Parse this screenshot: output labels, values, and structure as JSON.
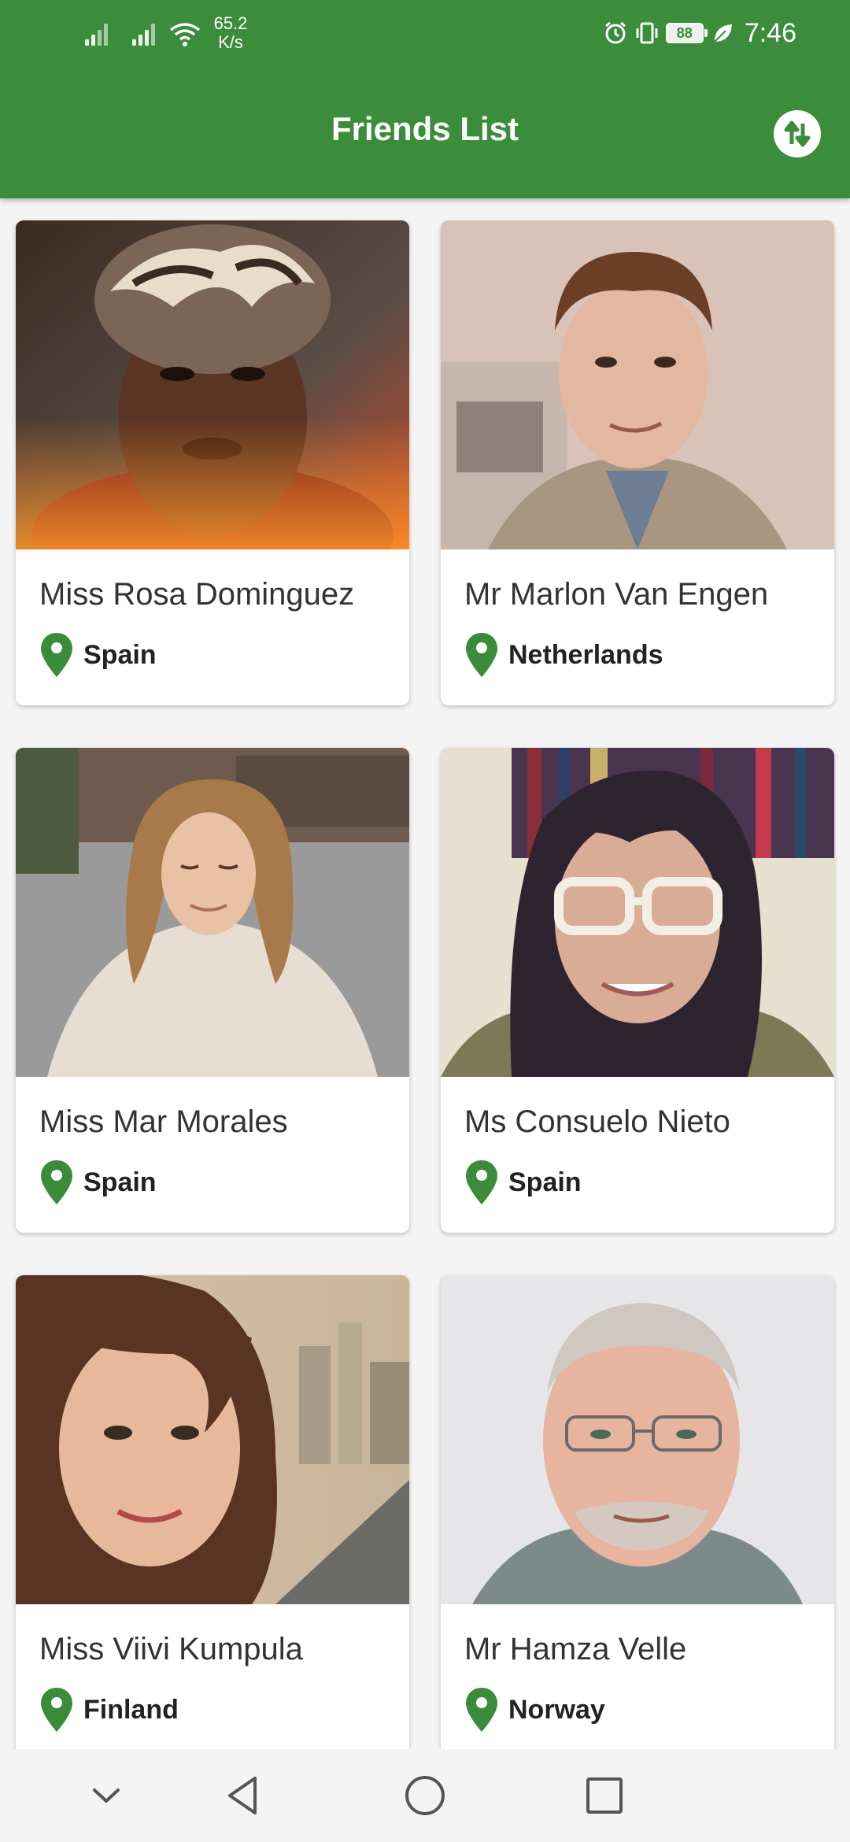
{
  "status_bar": {
    "network_speed_value": "65.2",
    "network_speed_unit": "K/s",
    "battery_level": "88",
    "time": "7:46",
    "icons": [
      "signal-icon",
      "signal-icon",
      "wifi-icon",
      "alarm-icon",
      "vibrate-icon",
      "battery-icon",
      "leaf-icon"
    ]
  },
  "header": {
    "title": "Friends List",
    "sort_icon": "sort-icon"
  },
  "friends": [
    {
      "name": "Miss Rosa Dominguez",
      "country": "Spain"
    },
    {
      "name": "Mr Marlon Van Engen",
      "country": "Netherlands"
    },
    {
      "name": "Miss Mar Morales",
      "country": "Spain"
    },
    {
      "name": "Ms Consuelo Nieto",
      "country": "Spain"
    },
    {
      "name": "Miss Viivi Kumpula",
      "country": "Finland"
    },
    {
      "name": "Mr Hamza Velle",
      "country": "Norway"
    }
  ],
  "nav_bar": {
    "icons": [
      "chevron-down-icon",
      "back-icon",
      "home-icon",
      "recents-icon"
    ]
  },
  "colors": {
    "accent": "#3b8d3b",
    "pin": "#3a8c3a",
    "background": "#f4f4f4"
  }
}
